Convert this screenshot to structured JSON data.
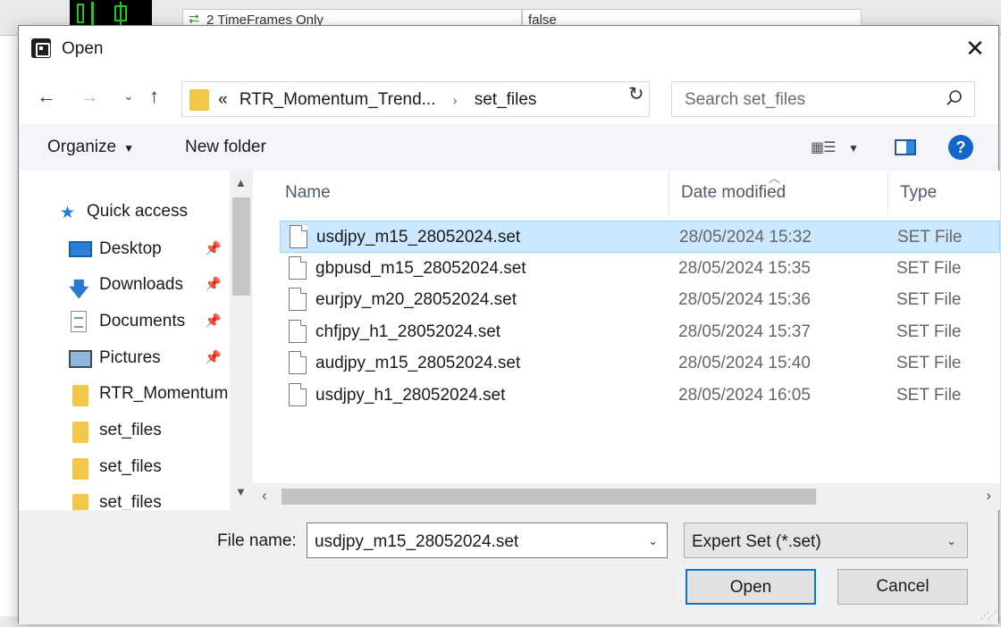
{
  "background": {
    "row_label": "2 TimeFrames Only",
    "row_value": "false"
  },
  "dialog": {
    "title": "Open",
    "close_glyph": "✕"
  },
  "nav": {
    "back_glyph": "←",
    "forward_glyph": "→",
    "recent_glyph": "⌄",
    "up_glyph": "↑",
    "address": {
      "prefix": "«",
      "crumbs": [
        "RTR_Momentum_Trend...",
        "set_files"
      ],
      "separator": "›"
    },
    "refresh_glyph": "↻",
    "search_placeholder": "Search set_files"
  },
  "toolbar": {
    "organize": "Organize",
    "new_folder": "New folder",
    "help_glyph": "?"
  },
  "sidebar": {
    "items": [
      {
        "label": "Quick access",
        "icon": "star-icon",
        "pinned": false
      },
      {
        "label": "Desktop",
        "icon": "desktop-icon",
        "pinned": true
      },
      {
        "label": "Downloads",
        "icon": "downloads-icon",
        "pinned": true
      },
      {
        "label": "Documents",
        "icon": "documents-icon",
        "pinned": true
      },
      {
        "label": "Pictures",
        "icon": "pictures-icon",
        "pinned": true
      },
      {
        "label": "RTR_Momentum",
        "icon": "folder-icon",
        "pinned": false
      },
      {
        "label": "set_files",
        "icon": "folder-icon",
        "pinned": false
      },
      {
        "label": "set_files",
        "icon": "folder-icon",
        "pinned": false
      },
      {
        "label": "set_files",
        "icon": "folder-icon",
        "pinned": false
      }
    ]
  },
  "filelist": {
    "columns": {
      "name": "Name",
      "date": "Date modified",
      "type": "Type"
    },
    "rows": [
      {
        "name": "usdjpy_m15_28052024.set",
        "date": "28/05/2024 15:32",
        "type": "SET File",
        "selected": true
      },
      {
        "name": "gbpusd_m15_28052024.set",
        "date": "28/05/2024 15:35",
        "type": "SET File",
        "selected": false
      },
      {
        "name": "eurjpy_m20_28052024.set",
        "date": "28/05/2024 15:36",
        "type": "SET File",
        "selected": false
      },
      {
        "name": "chfjpy_h1_28052024.set",
        "date": "28/05/2024 15:37",
        "type": "SET File",
        "selected": false
      },
      {
        "name": "audjpy_m15_28052024.set",
        "date": "28/05/2024 15:40",
        "type": "SET File",
        "selected": false
      },
      {
        "name": "usdjpy_h1_28052024.set",
        "date": "28/05/2024 16:05",
        "type": "SET File",
        "selected": false
      }
    ]
  },
  "footer": {
    "file_name_label": "File name:",
    "file_name_value": "usdjpy_m15_28052024.set",
    "file_type_value": "Expert Set (*.set)",
    "open_label": "Open",
    "cancel_label": "Cancel"
  },
  "colors": {
    "selection": "#cce8ff",
    "accent": "#0078d7",
    "folder": "#f3c84a"
  }
}
